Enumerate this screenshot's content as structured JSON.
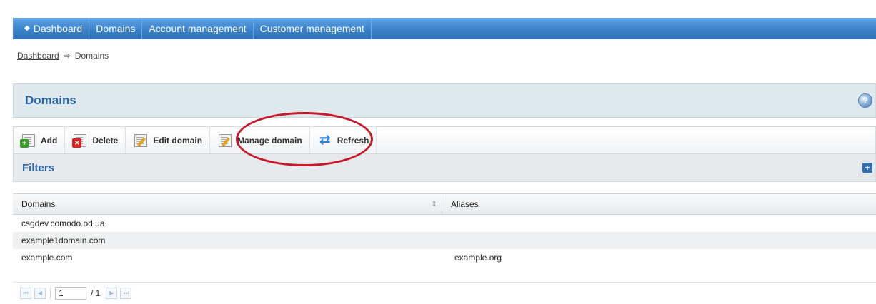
{
  "nav": {
    "items": [
      {
        "label": "Dashboard"
      },
      {
        "label": "Domains"
      },
      {
        "label": "Account management"
      },
      {
        "label": "Customer management"
      }
    ]
  },
  "breadcrumb": {
    "link": "Dashboard",
    "current": "Domains"
  },
  "page": {
    "title": "Domains"
  },
  "toolbar": {
    "add": "Add",
    "delete": "Delete",
    "edit": "Edit domain",
    "manage": "Manage domain",
    "refresh": "Refresh"
  },
  "filters": {
    "label": "Filters"
  },
  "table": {
    "columns": [
      "Domains",
      "Aliases"
    ],
    "rows": [
      {
        "domain": "csgdev.comodo.od.ua",
        "alias": ""
      },
      {
        "domain": "example1domain.com",
        "alias": ""
      },
      {
        "domain": "example.com",
        "alias": "example.org"
      }
    ]
  },
  "pager": {
    "page": "1",
    "total": "/ 1"
  },
  "colors": {
    "nav": "#3d84cc",
    "title": "#2a66a8",
    "highlight": "#c8192a"
  }
}
